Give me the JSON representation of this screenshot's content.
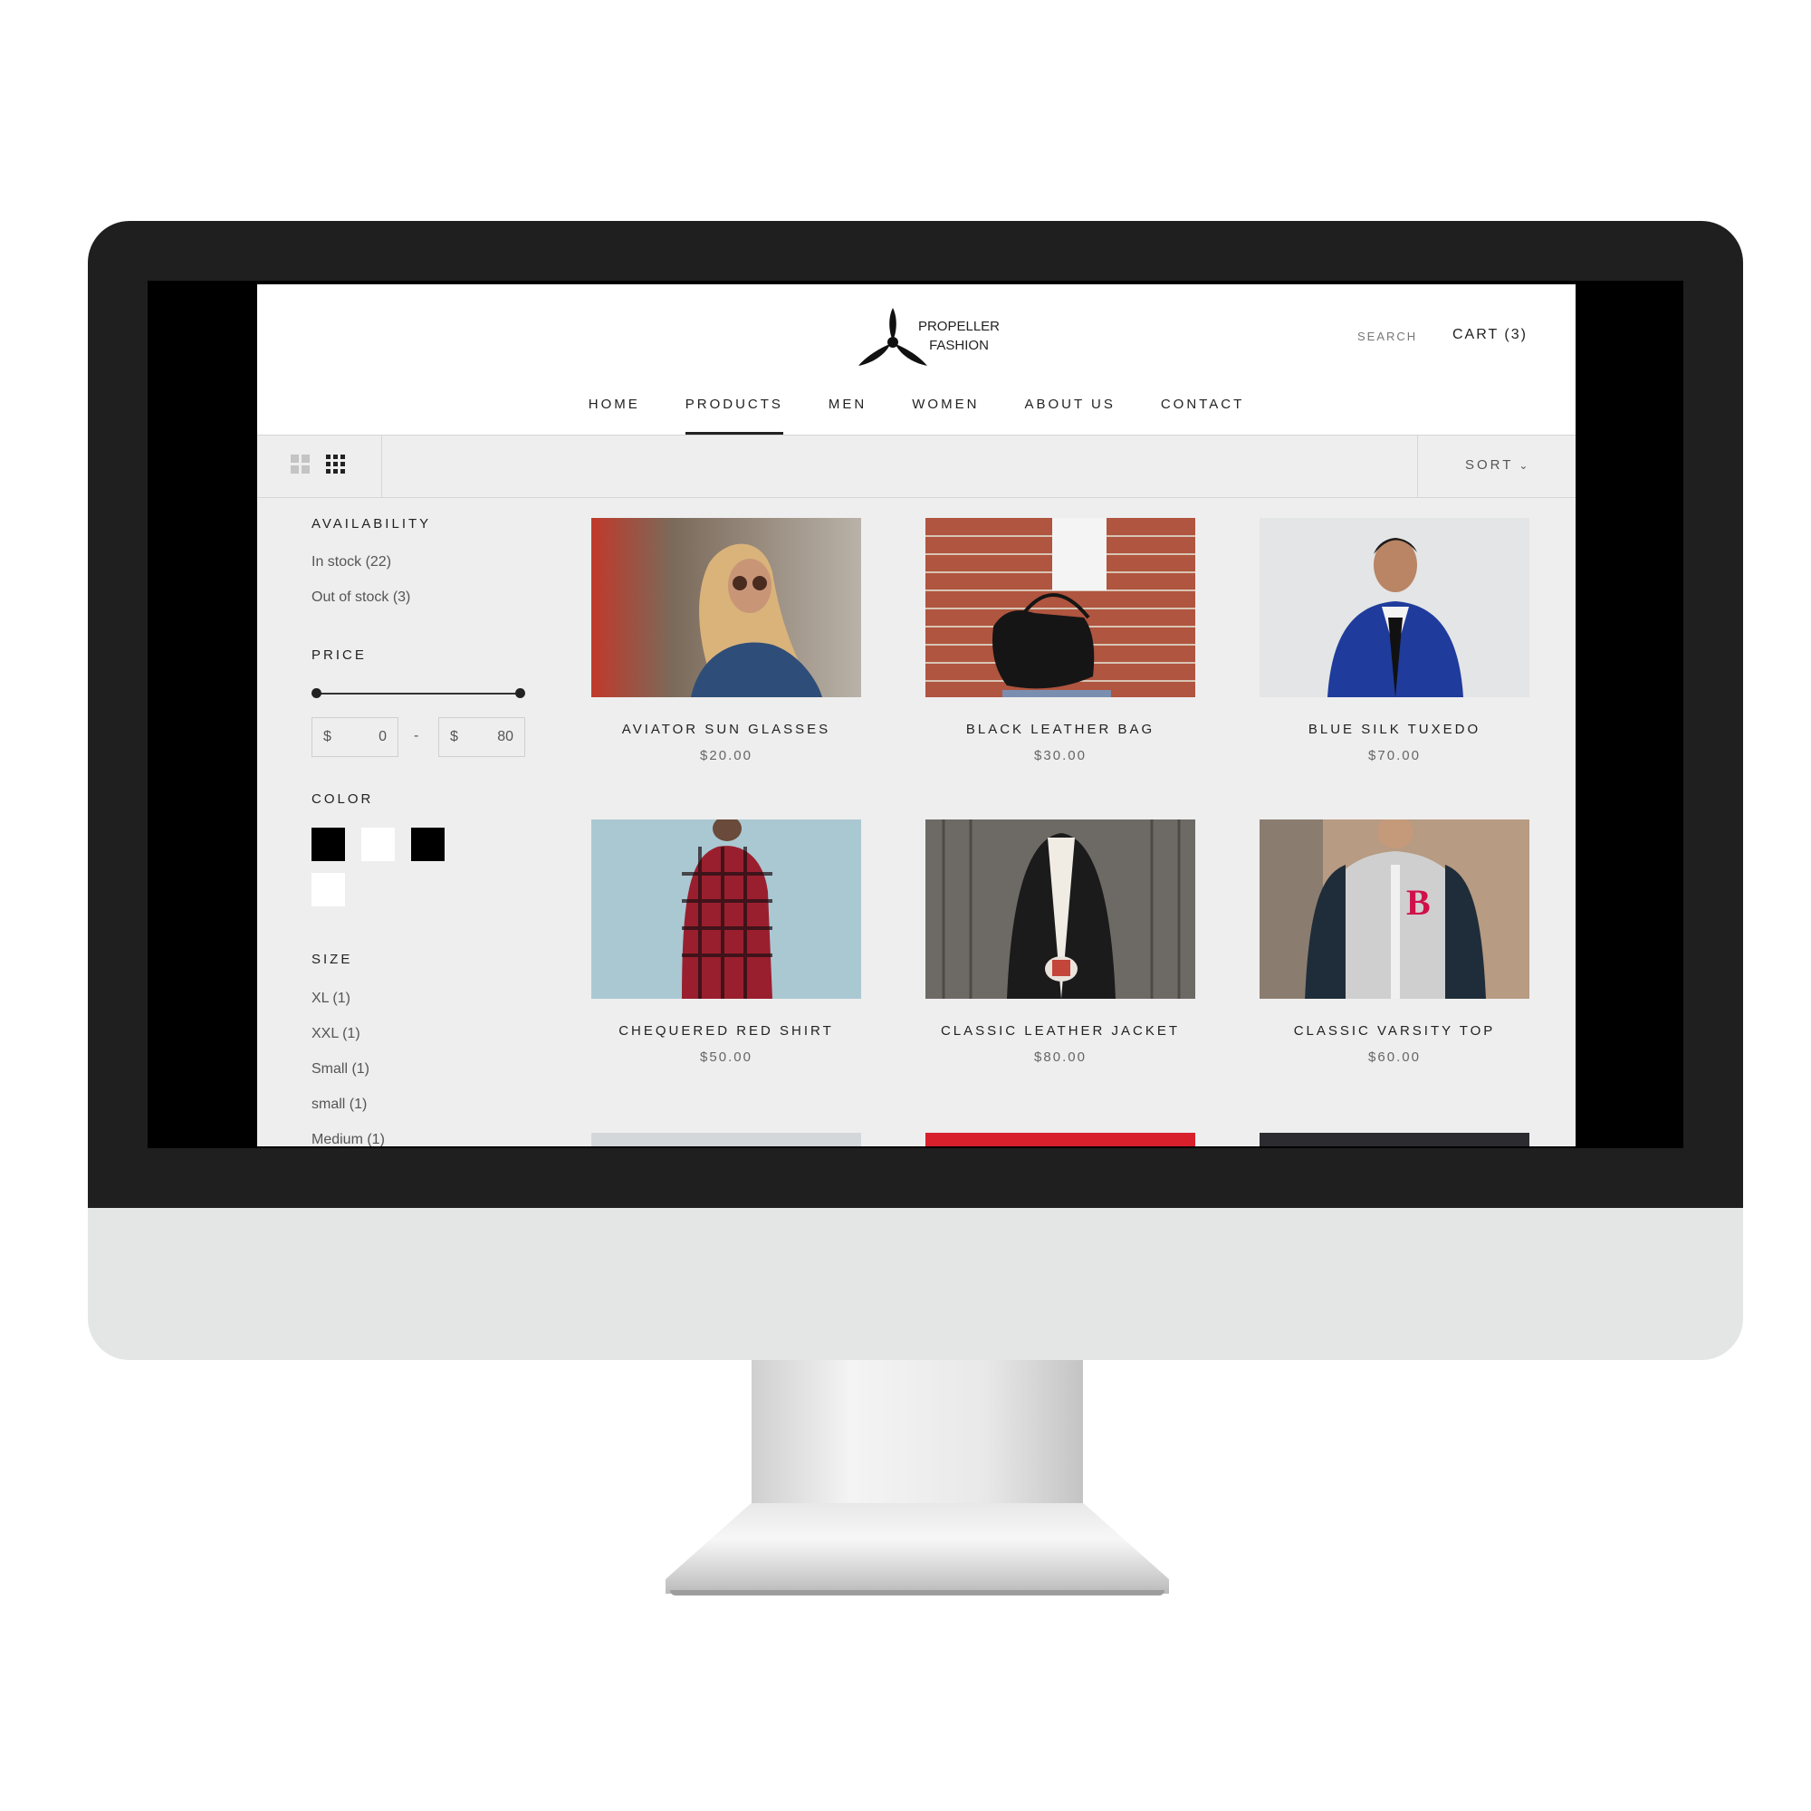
{
  "brand": {
    "line1": "PROPELLER",
    "line2": "FASHION"
  },
  "header": {
    "search_label": "SEARCH",
    "cart_label": "CART (3)"
  },
  "nav": {
    "items": [
      {
        "label": "HOME"
      },
      {
        "label": "PRODUCTS",
        "active": true
      },
      {
        "label": "MEN"
      },
      {
        "label": "WOMEN"
      },
      {
        "label": "ABOUT US"
      },
      {
        "label": "CONTACT"
      }
    ]
  },
  "toolbar": {
    "sort_label": "SORT"
  },
  "filters": {
    "availability": {
      "title": "AVAILABILITY",
      "options": [
        "In stock (22)",
        "Out of stock (3)"
      ]
    },
    "price": {
      "title": "PRICE",
      "currency": "$",
      "min": "0",
      "max": "80",
      "separator": "-"
    },
    "color": {
      "title": "COLOR",
      "swatches": [
        "#000000",
        "#ffffff",
        "#000000",
        "#ffffff"
      ]
    },
    "size": {
      "title": "SIZE",
      "options": [
        "XL (1)",
        "XXL (1)",
        "Small (1)",
        "small (1)",
        "Medium (1)"
      ]
    }
  },
  "products": [
    {
      "name": "AVIATOR SUN GLASSES",
      "price": "$20.00"
    },
    {
      "name": "BLACK LEATHER BAG",
      "price": "$30.00"
    },
    {
      "name": "BLUE SILK TUXEDO",
      "price": "$70.00"
    },
    {
      "name": "CHEQUERED RED SHIRT",
      "price": "$50.00"
    },
    {
      "name": "CLASSIC LEATHER JACKET",
      "price": "$80.00"
    },
    {
      "name": "CLASSIC VARSITY TOP",
      "price": "$60.00"
    }
  ]
}
